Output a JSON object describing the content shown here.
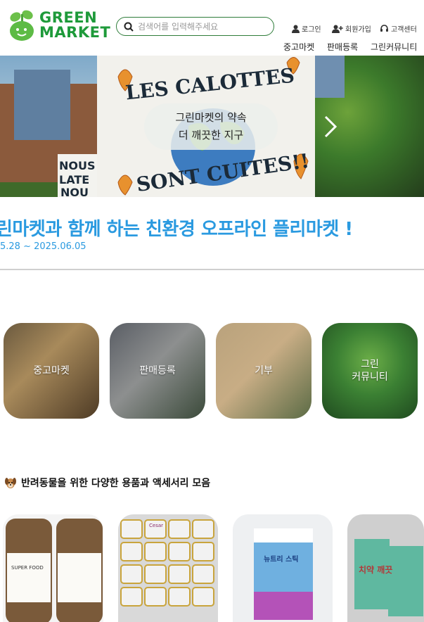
{
  "header": {
    "logo_line1": "GREEN",
    "logo_line2": "MARKET",
    "search_placeholder": "검색어를 입력해주세요",
    "util": {
      "login": "로그인",
      "signup": "회원가입",
      "support": "고객센터"
    },
    "nav": [
      "중고마켓",
      "판매등록",
      "그린커뮤니티"
    ]
  },
  "banner": {
    "line1": "그린마켓의 약속",
    "line2": "더 깨끗한 지구",
    "sign_text_1": "LES CALOTTES",
    "sign_text_2": "SONT CUITES!!",
    "left_sign": "NOUS LA TE NOU"
  },
  "event": {
    "title": "린마켓과 함께 하는 친환경 오프라인 플리마켓 !",
    "date": "5.28 ~ 2025.06.05"
  },
  "categories": [
    {
      "label": "중고마켓"
    },
    {
      "label": "판매등록"
    },
    {
      "label": "기부"
    },
    {
      "label_line1": "그린",
      "label_line2": "커뮤니티"
    }
  ],
  "section": {
    "title": "반려동물을 위한 다양한 용품과 액세서리 모음"
  },
  "products": [
    {
      "label": "SUPER FOOD"
    },
    {
      "label": "Cesar"
    },
    {
      "label": "뉴트리 스틱"
    },
    {
      "label": "치약 깨끗"
    }
  ],
  "colors": {
    "brand_green": "#1e9a3a",
    "accent_blue": "#2a9ae0"
  }
}
